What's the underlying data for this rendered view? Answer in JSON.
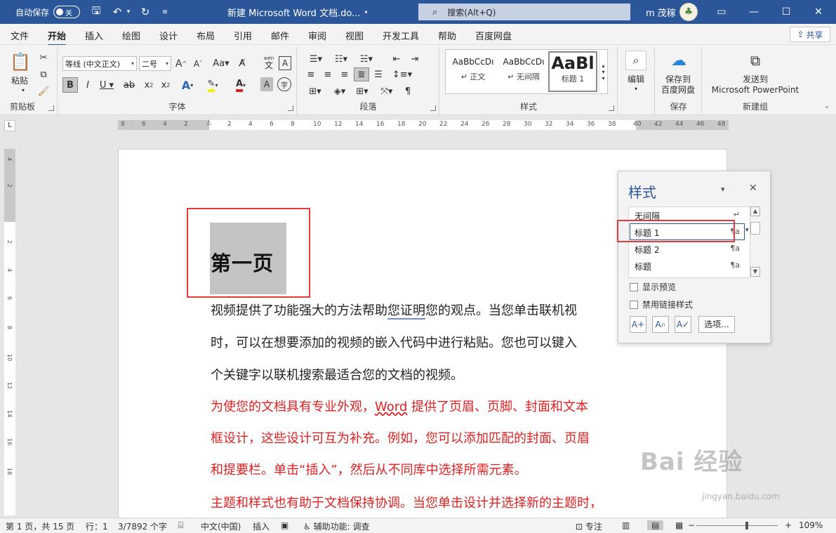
{
  "titlebar": {
    "autosave_label": "自动保存",
    "autosave_state": "关",
    "doc_title": "新建 Microsoft Word 文档.do...",
    "search_placeholder": "搜索(Alt+Q)",
    "user_name": "m 茂稼"
  },
  "menu": {
    "tabs": [
      "文件",
      "开始",
      "插入",
      "绘图",
      "设计",
      "布局",
      "引用",
      "邮件",
      "审阅",
      "视图",
      "开发工具",
      "帮助",
      "百度网盘"
    ],
    "active_tab": "开始",
    "share_label": "共享"
  },
  "ribbon": {
    "clipboard": {
      "paste_label": "粘贴",
      "group_label": "剪贴板"
    },
    "font": {
      "font_name": "等线 (中文正文)",
      "font_size": "二号",
      "group_label": "字体",
      "wen": "wén",
      "char_a": "A"
    },
    "paragraph": {
      "group_label": "段落"
    },
    "styles": {
      "group_label": "样式",
      "items": [
        {
          "sample": "AaBbCcDı",
          "name": "↵ 正文"
        },
        {
          "sample": "AaBbCcDı",
          "name": "↵ 无间隔"
        },
        {
          "sample": "AaBl",
          "name": "标题 1"
        }
      ]
    },
    "editing": {
      "label": "编辑"
    },
    "save": {
      "label_line1": "保存到",
      "label_line2": "百度网盘",
      "group_label": "保存"
    },
    "newgroup": {
      "label_line1": "发送到",
      "label_line2": "Microsoft PowerPoint",
      "group_label": "新建组"
    }
  },
  "ruler": {
    "corner": "L",
    "h_numbers": [
      "8",
      "6",
      "4",
      "2",
      "2",
      "4",
      "6",
      "8",
      "10",
      "12",
      "14",
      "16",
      "18",
      "20",
      "22",
      "24",
      "26",
      "28",
      "30",
      "32",
      "34",
      "36",
      "38",
      "40",
      "42",
      "44",
      "46",
      "48"
    ],
    "v_numbers": [
      "4",
      "2",
      "2",
      "4",
      "6",
      "8",
      "10",
      "12",
      "14",
      "16",
      "18"
    ]
  },
  "document": {
    "heading": "第一页",
    "para1": [
      {
        "text": "视频提供了功能强大的方法帮助"
      },
      {
        "text": "您证明"
      },
      {
        "text": "您的观点。当您单击联机视"
      }
    ],
    "para1_line2": "时，可以在想要添加的视频的嵌入代码中进行粘贴。您也可以键入",
    "para1_line3": "个关键字以联机搜索最适合您的文档的视频。",
    "para2_line1_a": "为使您的文档具有专业外观，",
    "para2_line1_word": "Word",
    "para2_line1_b": " 提供了页眉、页脚、封面和文本",
    "para2_line2": "框设计，这些设计可互为补充。例如，您可以添加匹配的封面、页眉",
    "para2_line3": "和提要栏。单击“插入”，然后从不同库中选择所需元素。",
    "para3_line1": "主题和样式也有助于文档保持协调。当您单击设计并选择新的主题时，"
  },
  "styles_pane": {
    "title": "样式",
    "items": [
      {
        "name": "无间隔",
        "mark": "↵"
      },
      {
        "name": "标题 1",
        "mark": "¶a"
      },
      {
        "name": "标题 2",
        "mark": "¶a"
      },
      {
        "name": "标题",
        "mark": "¶a"
      }
    ],
    "show_preview": "显示预览",
    "disable_linked": "禁用链接样式",
    "options_label": "选项..."
  },
  "statusbar": {
    "page": "第 1 页，共 15 页",
    "line": "行：1",
    "words": "3/7892 个字",
    "language": "中文(中国)",
    "insert_mode": "插入",
    "accessibility": "辅助功能: 调查",
    "focus": "专注",
    "zoom": "109%",
    "zoom_level": 0.6
  },
  "watermark": {
    "text": "Bai 经验",
    "sub": "jingyan.baidu.com"
  },
  "colors": {
    "accent": "#2b579a",
    "highlight_red": "#e83a3a",
    "text_red": "#e02020"
  }
}
